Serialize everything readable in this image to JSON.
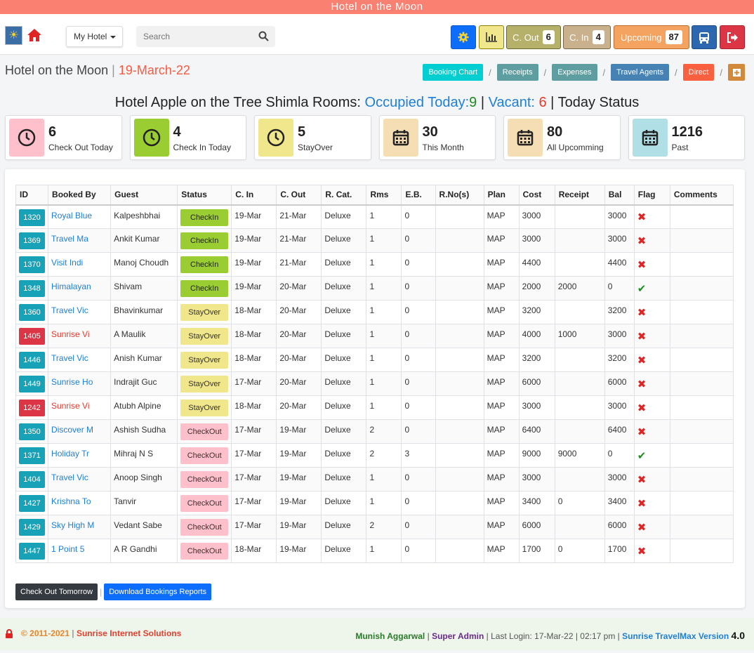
{
  "app": {
    "banner": "Hotel on the Moon"
  },
  "nav": {
    "hotel_dropdown": "My Hotel",
    "search_placeholder": "Search",
    "c_out_label": "C. Out",
    "c_out_count": "6",
    "c_in_label": "C. In",
    "c_in_count": "4",
    "upcoming_label": "Upcoming",
    "upcoming_count": "87"
  },
  "header": {
    "hotel": "Hotel on the Moon",
    "sep": "|",
    "date": "19-March-22",
    "crumbs": [
      "Booking Chart",
      "Receipts",
      "Expenses",
      "Travel Agents",
      "Direct"
    ]
  },
  "status_line": {
    "prefix": "Hotel Apple on the Tree Shimla Rooms:",
    "occupied_label": "Occupied Today:",
    "occupied": "9",
    "vacant_label": "Vacant:",
    "vacant": "6",
    "suffix": "Today Status"
  },
  "cards": [
    {
      "num": "6",
      "label": "Check Out Today",
      "bg": "#ffc0cb",
      "icon": "clock-icon"
    },
    {
      "num": "4",
      "label": "Check In Today",
      "bg": "#9acd32",
      "icon": "clock-icon"
    },
    {
      "num": "5",
      "label": "StayOver",
      "bg": "#f0e68c",
      "icon": "clock-icon"
    },
    {
      "num": "30",
      "label": "This Month",
      "bg": "#f5deb3",
      "icon": "calendar-icon"
    },
    {
      "num": "80",
      "label": "All Upcomming",
      "bg": "#f5deb3",
      "icon": "calendar-icon"
    },
    {
      "num": "1216",
      "label": "Past",
      "bg": "#b0e0e6",
      "icon": "calendar-icon"
    }
  ],
  "table": {
    "columns": [
      "ID",
      "Booked By",
      "Guest",
      "Status",
      "C. In",
      "C. Out",
      "R. Cat.",
      "Rms",
      "E.B.",
      "R.No(s)",
      "Plan",
      "Cost",
      "Receipt",
      "Bal",
      "Flag",
      "Comments"
    ],
    "rows": [
      {
        "id": "1320",
        "idc": "teal",
        "by": "Royal Blue",
        "byc": "blue",
        "guest": "Kalpeshbhai",
        "status": "CheckIn",
        "cin": "19-Mar",
        "cout": "21-Mar",
        "cat": "Deluxe",
        "rms": "1",
        "eb": "0",
        "rno": "",
        "plan": "MAP",
        "cost": "3000",
        "receipt": "",
        "bal": "3000",
        "flag": "x",
        "comments": ""
      },
      {
        "id": "1369",
        "idc": "teal",
        "by": "Travel Ma",
        "byc": "blue",
        "guest": "Ankit Kumar",
        "status": "CheckIn",
        "cin": "19-Mar",
        "cout": "21-Mar",
        "cat": "Deluxe",
        "rms": "1",
        "eb": "0",
        "rno": "",
        "plan": "MAP",
        "cost": "3000",
        "receipt": "",
        "bal": "3000",
        "flag": "x",
        "comments": ""
      },
      {
        "id": "1370",
        "idc": "teal",
        "by": "Visit Indi",
        "byc": "blue",
        "guest": "Manoj Choudh",
        "status": "CheckIn",
        "cin": "19-Mar",
        "cout": "21-Mar",
        "cat": "Deluxe",
        "rms": "1",
        "eb": "0",
        "rno": "",
        "plan": "MAP",
        "cost": "4400",
        "receipt": "",
        "bal": "4400",
        "flag": "x",
        "comments": ""
      },
      {
        "id": "1348",
        "idc": "teal",
        "by": "Himalayan",
        "byc": "blue",
        "guest": "Shivam",
        "status": "CheckIn",
        "cin": "19-Mar",
        "cout": "20-Mar",
        "cat": "Deluxe",
        "rms": "1",
        "eb": "0",
        "rno": "",
        "plan": "MAP",
        "cost": "2000",
        "receipt": "2000",
        "bal": "0",
        "flag": "ok",
        "comments": ""
      },
      {
        "id": "1360",
        "idc": "teal",
        "by": "Travel Vic",
        "byc": "blue",
        "guest": "Bhavinkumar",
        "status": "StayOver",
        "cin": "18-Mar",
        "cout": "20-Mar",
        "cat": "Deluxe",
        "rms": "1",
        "eb": "0",
        "rno": "",
        "plan": "MAP",
        "cost": "3200",
        "receipt": "",
        "bal": "3200",
        "flag": "x",
        "comments": ""
      },
      {
        "id": "1405",
        "idc": "red",
        "by": "Sunrise Vi",
        "byc": "red",
        "guest": "A Maulik",
        "status": "StayOver",
        "cin": "18-Mar",
        "cout": "20-Mar",
        "cat": "Deluxe",
        "rms": "1",
        "eb": "0",
        "rno": "",
        "plan": "MAP",
        "cost": "4000",
        "receipt": "1000",
        "bal": "3000",
        "flag": "x",
        "comments": ""
      },
      {
        "id": "1446",
        "idc": "teal",
        "by": "Travel Vic",
        "byc": "blue",
        "guest": "Anish Kumar",
        "status": "StayOver",
        "cin": "18-Mar",
        "cout": "20-Mar",
        "cat": "Deluxe",
        "rms": "1",
        "eb": "0",
        "rno": "",
        "plan": "MAP",
        "cost": "3200",
        "receipt": "",
        "bal": "3200",
        "flag": "x",
        "comments": ""
      },
      {
        "id": "1449",
        "idc": "teal",
        "by": "Sunrise Ho",
        "byc": "blue",
        "guest": "Indrajit Guc",
        "status": "StayOver",
        "cin": "17-Mar",
        "cout": "20-Mar",
        "cat": "Deluxe",
        "rms": "1",
        "eb": "0",
        "rno": "",
        "plan": "MAP",
        "cost": "6000",
        "receipt": "",
        "bal": "6000",
        "flag": "x",
        "comments": ""
      },
      {
        "id": "1242",
        "idc": "red",
        "by": "Sunrise Vi",
        "byc": "red",
        "guest": "Atubh Alpine",
        "status": "StayOver",
        "cin": "18-Mar",
        "cout": "20-Mar",
        "cat": "Deluxe",
        "rms": "1",
        "eb": "0",
        "rno": "",
        "plan": "MAP",
        "cost": "3000",
        "receipt": "",
        "bal": "3000",
        "flag": "x",
        "comments": ""
      },
      {
        "id": "1350",
        "idc": "teal",
        "by": "Discover M",
        "byc": "blue",
        "guest": "Ashish Sudha",
        "status": "CheckOut",
        "cin": "17-Mar",
        "cout": "19-Mar",
        "cat": "Deluxe",
        "rms": "2",
        "eb": "0",
        "rno": "",
        "plan": "MAP",
        "cost": "6400",
        "receipt": "",
        "bal": "6400",
        "flag": "x",
        "comments": ""
      },
      {
        "id": "1371",
        "idc": "teal",
        "by": "Holiday Tr",
        "byc": "blue",
        "guest": "Mihraj N S",
        "status": "CheckOut",
        "cin": "17-Mar",
        "cout": "19-Mar",
        "cat": "Deluxe",
        "rms": "2",
        "eb": "3",
        "rno": "",
        "plan": "MAP",
        "cost": "9000",
        "receipt": "9000",
        "bal": "0",
        "flag": "ok",
        "comments": ""
      },
      {
        "id": "1404",
        "idc": "teal",
        "by": "Travel Vic",
        "byc": "blue",
        "guest": "Anoop Singh",
        "status": "CheckOut",
        "cin": "17-Mar",
        "cout": "19-Mar",
        "cat": "Deluxe",
        "rms": "1",
        "eb": "0",
        "rno": "",
        "plan": "MAP",
        "cost": "3000",
        "receipt": "",
        "bal": "3000",
        "flag": "x",
        "comments": ""
      },
      {
        "id": "1427",
        "idc": "teal",
        "by": "Krishna To",
        "byc": "blue",
        "guest": "Tanvir",
        "status": "CheckOut",
        "cin": "17-Mar",
        "cout": "19-Mar",
        "cat": "Deluxe",
        "rms": "1",
        "eb": "0",
        "rno": "",
        "plan": "MAP",
        "cost": "3400",
        "receipt": "0",
        "bal": "3400",
        "flag": "x",
        "comments": ""
      },
      {
        "id": "1429",
        "idc": "teal",
        "by": "Sky High M",
        "byc": "blue",
        "guest": "Vedant Sabe",
        "status": "CheckOut",
        "cin": "17-Mar",
        "cout": "19-Mar",
        "cat": "Deluxe",
        "rms": "2",
        "eb": "0",
        "rno": "",
        "plan": "MAP",
        "cost": "6000",
        "receipt": "",
        "bal": "6000",
        "flag": "x",
        "comments": ""
      },
      {
        "id": "1447",
        "idc": "teal",
        "by": "1 Point 5",
        "byc": "blue",
        "guest": "A R Gandhi",
        "status": "CheckOut",
        "cin": "18-Mar",
        "cout": "19-Mar",
        "cat": "Deluxe",
        "rms": "1",
        "eb": "0",
        "rno": "",
        "plan": "MAP",
        "cost": "1700",
        "receipt": "0",
        "bal": "1700",
        "flag": "x",
        "comments": ""
      }
    ]
  },
  "bottom": {
    "checkout_tomorrow": "Check Out Tomorrow",
    "divider": "|",
    "download": "Download Bookings Reports"
  },
  "footer": {
    "copyright": "© 2011-2021",
    "sep": "|",
    "company": "Sunrise Internet Solutions",
    "user": "Munish Aggarwal",
    "role": "Super Admin",
    "last_login": "Last Login: 17-Mar-22 | 02:17 pm",
    "product": "Sunrise TravelMax Version",
    "version": "4.0"
  }
}
